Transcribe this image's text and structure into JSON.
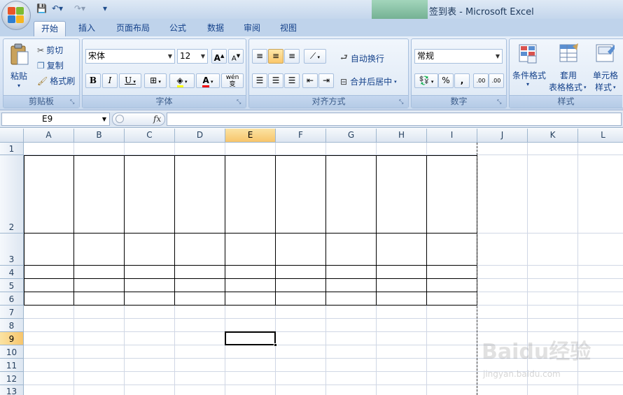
{
  "window": {
    "title": "签到表 - Microsoft Excel"
  },
  "tabs": [
    {
      "label": "开始",
      "active": true
    },
    {
      "label": "插入"
    },
    {
      "label": "页面布局"
    },
    {
      "label": "公式"
    },
    {
      "label": "数据"
    },
    {
      "label": "审阅"
    },
    {
      "label": "视图"
    }
  ],
  "ribbon": {
    "clipboard": {
      "label": "剪贴板",
      "paste": "粘贴",
      "cut": "剪切",
      "copy": "复制",
      "format_painter": "格式刷"
    },
    "font": {
      "label": "字体",
      "font_name": "宋体",
      "font_size": "12",
      "bold": "B",
      "italic": "I",
      "underline": "U",
      "increase": "A",
      "decrease": "A",
      "wen": "wén",
      "zi": "变"
    },
    "alignment": {
      "label": "对齐方式",
      "wrap_text": "自动换行",
      "merge_center": "合并后居中"
    },
    "number": {
      "label": "数字",
      "format": "常规",
      "percent": "%",
      "comma": ",",
      "inc_decimal": ".00",
      "dec_decimal": ".00"
    },
    "styles": {
      "label": "样式",
      "conditional": "条件格式",
      "table_format_1": "套用",
      "table_format_2": "表格格式",
      "cell_styles_1": "单元格",
      "cell_styles_2": "样式"
    }
  },
  "formula_bar": {
    "name_box": "E9",
    "fx": "fx",
    "formula": ""
  },
  "sheet": {
    "columns": [
      "A",
      "B",
      "C",
      "D",
      "E",
      "F",
      "G",
      "H",
      "I",
      "J",
      "K",
      "L"
    ],
    "rows": [
      "1",
      "2",
      "3",
      "4",
      "5",
      "6",
      "7",
      "8",
      "9",
      "10",
      "11",
      "12",
      "13"
    ],
    "selected_column": "E",
    "selected_row": "9",
    "active_cell": "E9"
  },
  "watermark": {
    "text": "Baidu经验",
    "url": "jingyan.baidu.com"
  },
  "colors": {
    "accent": "#15428b",
    "selection": "#f7c56b",
    "ribbon": "#d5e2f3"
  }
}
